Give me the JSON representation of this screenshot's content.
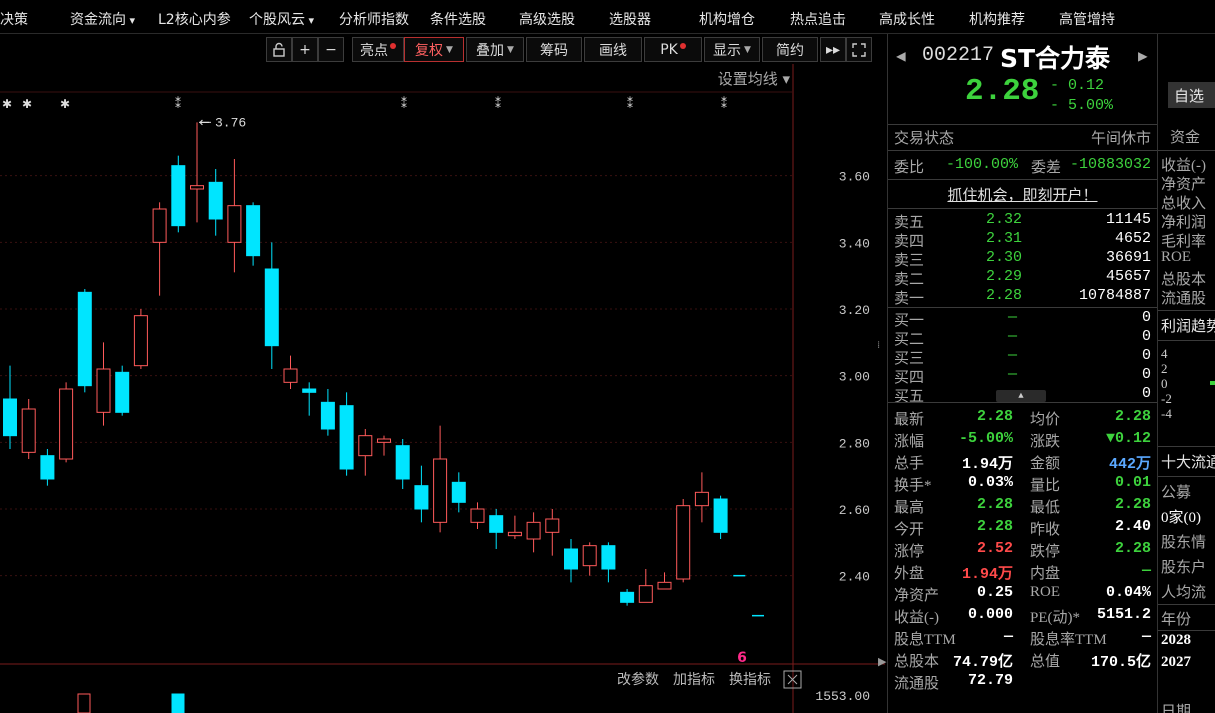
{
  "menu": [
    "决策",
    "资金流向",
    "L2核心内参",
    "个股风云",
    "分析师指数",
    "条件选股",
    "高级选股",
    "选股器",
    "机构增仓",
    "热点追击",
    "高成长性",
    "机构推荐",
    "高管增持"
  ],
  "toolbar": {
    "liangdian": "亮点",
    "fuquan": "复权",
    "diejia": "叠加",
    "chouma": "筹码",
    "huaxian": "画线",
    "pk": "PK",
    "xianshi": "显示",
    "jianyue": "简约",
    "settings_ma": "设置均线"
  },
  "chart": {
    "price_ticks": [
      "3.60",
      "3.40",
      "3.20",
      "3.00",
      "2.80",
      "2.60",
      "2.40"
    ],
    "high_label": "3.76",
    "volume_label": "1553.00",
    "bottom_links": [
      "改参数",
      "加指标",
      "换指标"
    ],
    "colors": {
      "up": "#ff5a5a",
      "down": "#00e5ff",
      "grid": "#3a1010",
      "axis_text": "#c8c8c8"
    },
    "marker_char": "6"
  },
  "chart_data": {
    "type": "candlestick",
    "ylim": [
      2.24,
      3.8
    ],
    "candles": [
      {
        "o": 2.93,
        "c": 2.82,
        "h": 3.03,
        "l": 2.78
      },
      {
        "o": 2.77,
        "c": 2.9,
        "h": 2.93,
        "l": 2.75
      },
      {
        "o": 2.76,
        "c": 2.69,
        "h": 2.78,
        "l": 2.67
      },
      {
        "o": 2.75,
        "c": 2.96,
        "h": 2.98,
        "l": 2.74
      },
      {
        "o": 3.25,
        "c": 2.97,
        "h": 3.26,
        "l": 2.95
      },
      {
        "o": 2.89,
        "c": 3.02,
        "h": 3.1,
        "l": 2.85
      },
      {
        "o": 3.01,
        "c": 2.89,
        "h": 3.03,
        "l": 2.88
      },
      {
        "o": 3.03,
        "c": 3.18,
        "h": 3.2,
        "l": 3.02
      },
      {
        "o": 3.4,
        "c": 3.5,
        "h": 3.52,
        "l": 3.24
      },
      {
        "o": 3.63,
        "c": 3.45,
        "h": 3.66,
        "l": 3.43
      },
      {
        "o": 3.56,
        "c": 3.57,
        "h": 3.76,
        "l": 3.46
      },
      {
        "o": 3.58,
        "c": 3.47,
        "h": 3.62,
        "l": 3.42
      },
      {
        "o": 3.4,
        "c": 3.51,
        "h": 3.65,
        "l": 3.31
      },
      {
        "o": 3.51,
        "c": 3.36,
        "h": 3.52,
        "l": 3.33
      },
      {
        "o": 3.32,
        "c": 3.09,
        "h": 3.4,
        "l": 3.02
      },
      {
        "o": 2.98,
        "c": 3.02,
        "h": 3.06,
        "l": 2.96
      },
      {
        "o": 2.96,
        "c": 2.95,
        "h": 2.98,
        "l": 2.88
      },
      {
        "o": 2.92,
        "c": 2.84,
        "h": 2.96,
        "l": 2.82
      },
      {
        "o": 2.91,
        "c": 2.72,
        "h": 2.95,
        "l": 2.7
      },
      {
        "o": 2.76,
        "c": 2.82,
        "h": 2.84,
        "l": 2.7
      },
      {
        "o": 2.8,
        "c": 2.81,
        "h": 2.82,
        "l": 2.76
      },
      {
        "o": 2.79,
        "c": 2.69,
        "h": 2.81,
        "l": 2.66
      },
      {
        "o": 2.67,
        "c": 2.6,
        "h": 2.73,
        "l": 2.56
      },
      {
        "o": 2.56,
        "c": 2.75,
        "h": 2.85,
        "l": 2.53
      },
      {
        "o": 2.68,
        "c": 2.62,
        "h": 2.71,
        "l": 2.59
      },
      {
        "o": 2.56,
        "c": 2.6,
        "h": 2.62,
        "l": 2.54
      },
      {
        "o": 2.58,
        "c": 2.53,
        "h": 2.6,
        "l": 2.48
      },
      {
        "o": 2.52,
        "c": 2.53,
        "h": 2.58,
        "l": 2.51
      },
      {
        "o": 2.51,
        "c": 2.56,
        "h": 2.59,
        "l": 2.47
      },
      {
        "o": 2.53,
        "c": 2.57,
        "h": 2.6,
        "l": 2.46
      },
      {
        "o": 2.48,
        "c": 2.42,
        "h": 2.51,
        "l": 2.38
      },
      {
        "o": 2.43,
        "c": 2.49,
        "h": 2.5,
        "l": 2.4
      },
      {
        "o": 2.49,
        "c": 2.42,
        "h": 2.5,
        "l": 2.38
      },
      {
        "o": 2.35,
        "c": 2.32,
        "h": 2.36,
        "l": 2.31
      },
      {
        "o": 2.32,
        "c": 2.37,
        "h": 2.42,
        "l": 2.32
      },
      {
        "o": 2.36,
        "c": 2.38,
        "h": 2.41,
        "l": 2.36
      },
      {
        "o": 2.39,
        "c": 2.61,
        "h": 2.63,
        "l": 2.38
      },
      {
        "o": 2.61,
        "c": 2.65,
        "h": 2.71,
        "l": 2.56
      },
      {
        "o": 2.63,
        "c": 2.53,
        "h": 2.64,
        "l": 2.51
      },
      {
        "o": 2.4,
        "c": 2.4,
        "h": 2.4,
        "l": 2.4
      },
      {
        "o": 2.28,
        "c": 2.28,
        "h": 2.28,
        "l": 2.28
      }
    ]
  },
  "quote": {
    "code": "002217",
    "name": "ST合力泰",
    "price": "2.28",
    "change": "- 0.12",
    "change_pct": "- 5.00%",
    "watch_label": "自选",
    "status_label": "交易状态",
    "status_value": "午间休市",
    "weibi_label": "委比",
    "weibi_value": "-100.00%",
    "weicha_label": "委差",
    "weicha_value": "-10883032",
    "banner": "抓住机会，即刻开户！",
    "asks": [
      {
        "label": "卖五",
        "price": "2.32",
        "vol": "11145"
      },
      {
        "label": "卖四",
        "price": "2.31",
        "vol": "4652"
      },
      {
        "label": "卖三",
        "price": "2.30",
        "vol": "36691"
      },
      {
        "label": "卖二",
        "price": "2.29",
        "vol": "45657"
      },
      {
        "label": "卖一",
        "price": "2.28",
        "vol": "10784887"
      }
    ],
    "bids": [
      {
        "label": "买一",
        "price": "—",
        "vol": "0"
      },
      {
        "label": "买二",
        "price": "—",
        "vol": "0"
      },
      {
        "label": "买三",
        "price": "—",
        "vol": "0"
      },
      {
        "label": "买四",
        "price": "—",
        "vol": "0"
      },
      {
        "label": "买五",
        "price": "—",
        "vol": "0"
      }
    ],
    "stats": [
      {
        "l1": "最新",
        "v1": "2.28",
        "c1": "green",
        "l2": "均价",
        "v2": "2.28",
        "c2": "green"
      },
      {
        "l1": "涨幅",
        "v1": "-5.00%",
        "c1": "green",
        "l2": "涨跌",
        "v2": "▼0.12",
        "c2": "green"
      },
      {
        "l1": "总手",
        "v1": "1.94万",
        "c1": "white",
        "l2": "金额",
        "v2": "442万",
        "c2": "cyan"
      },
      {
        "l1": "换手*",
        "v1": "0.03%",
        "c1": "white",
        "l2": "量比",
        "v2": "0.01",
        "c2": "green"
      },
      {
        "l1": "最高",
        "v1": "2.28",
        "c1": "green",
        "l2": "最低",
        "v2": "2.28",
        "c2": "green"
      },
      {
        "l1": "今开",
        "v1": "2.28",
        "c1": "green",
        "l2": "昨收",
        "v2": "2.40",
        "c2": "white"
      },
      {
        "l1": "涨停",
        "v1": "2.52",
        "c1": "red",
        "l2": "跌停",
        "v2": "2.28",
        "c2": "green"
      },
      {
        "l1": "外盘",
        "v1": "1.94万",
        "c1": "red",
        "l2": "内盘",
        "v2": "—",
        "c2": "green"
      },
      {
        "l1": "净资产",
        "v1": "0.25",
        "c1": "white",
        "l2": "ROE",
        "v2": "0.04%",
        "c2": "white"
      },
      {
        "l1": "收益(-)",
        "v1": "0.000",
        "c1": "white",
        "l2": "PE(动)*",
        "v2": "5151.2",
        "c2": "white"
      },
      {
        "l1": "股息TTM",
        "v1": "—",
        "c1": "white",
        "l2": "股息率TTM",
        "v2": "—",
        "c2": "white"
      },
      {
        "l1": "总股本",
        "v1": "74.79亿",
        "c1": "white",
        "l2": "总值",
        "v2": "170.5亿",
        "c2": "white"
      },
      {
        "l1": "流通股",
        "v1": "72.79",
        "c1": "white",
        "l2": "",
        "v2": "",
        "c2": "white"
      }
    ]
  },
  "side": {
    "header": "资金",
    "items": [
      "收益(-)",
      "净资产",
      "总收入",
      "净利润",
      "毛利率",
      "ROE",
      "总股本",
      "流通股"
    ],
    "profit_trend": "利润趋势",
    "axis": [
      "4",
      "2",
      "0",
      "-2",
      "-4"
    ],
    "top10": "十大流通",
    "gongmu": "公募",
    "gongmu_val": "0家(0)",
    "more": [
      "股东情",
      "股东户",
      "人均流"
    ],
    "year_label": "年份",
    "years": [
      "2028",
      "2027"
    ],
    "date_label": "日期"
  }
}
